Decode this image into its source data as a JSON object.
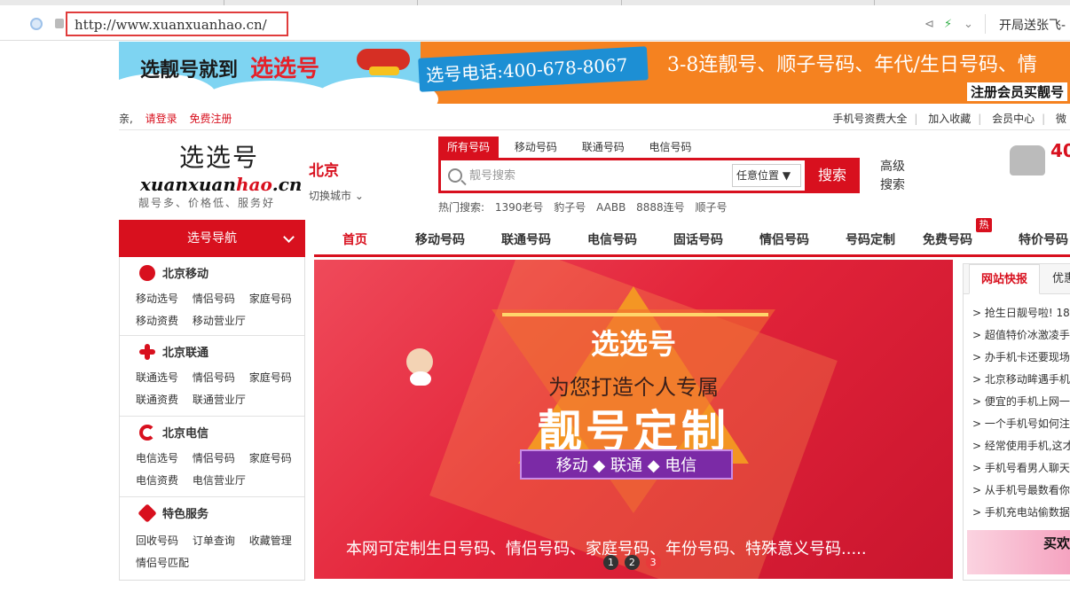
{
  "browser": {
    "url": "http://www.xuanxuanhao.cn/",
    "title": "开局送张飞-"
  },
  "banner": {
    "slogan_prefix": "选靓号就到",
    "slogan_brand": "选选号",
    "phone": "选号电话:400-678-8067",
    "promo": "3-8连靓号、顺子号码、年代/生日号码、情",
    "register": "注册会员买靓号"
  },
  "topbar": {
    "greeting": "亲,",
    "login": "请登录",
    "register": "免费注册",
    "links": [
      "手机号资费大全",
      "加入收藏",
      "会员中心",
      "微"
    ]
  },
  "header": {
    "logo_cn": "选选号",
    "logo_en_a": "xuanxuan",
    "logo_en_b": "hao",
    "logo_en_c": ".cn",
    "logo_tag": "靓号多、价格低、服务好",
    "city": "北京",
    "city_switch": "切换城市",
    "search_tabs": [
      "所有号码",
      "移动号码",
      "联通号码",
      "电信号码"
    ],
    "search_placeholder": "靓号搜索",
    "search_position": "任意位置",
    "search_button": "搜索",
    "advanced_search": "高级搜索",
    "hot_search_label": "热门搜索:",
    "hot_search": [
      "1390老号",
      "豹子号",
      "AABB",
      "8888连号",
      "顺子号"
    ],
    "hotline": "40"
  },
  "nav": {
    "title": "选号导航",
    "links": [
      "首页",
      "移动号码",
      "联通号码",
      "电信号码",
      "固话号码",
      "情侣号码",
      "号码定制",
      "免费号码",
      "特价号码"
    ],
    "hot_badge": "热"
  },
  "sidebar": {
    "groups": [
      {
        "title": "北京移动",
        "rows": [
          [
            "移动选号",
            "情侣号码",
            "家庭号码"
          ],
          [
            "移动资费",
            "移动营业厅"
          ]
        ]
      },
      {
        "title": "北京联通",
        "rows": [
          [
            "联通选号",
            "情侣号码",
            "家庭号码"
          ],
          [
            "联通资费",
            "联通营业厅"
          ]
        ]
      },
      {
        "title": "北京电信",
        "rows": [
          [
            "电信选号",
            "情侣号码",
            "家庭号码"
          ],
          [
            "电信资费",
            "电信营业厅"
          ]
        ]
      },
      {
        "title": "特色服务",
        "rows": [
          [
            "回收号码",
            "订单查询",
            "收藏管理"
          ],
          [
            "情侣号匹配"
          ]
        ]
      }
    ]
  },
  "hero": {
    "brand": "选选号",
    "sub": "为您打造个人专属",
    "main": "靓号定制",
    "carriers": "移动 ◆ 联通 ◆ 电信",
    "caption": "本网可定制生日号码、情侣号码、家庭号码、年份号码、特殊意义号码.....",
    "dots": [
      "1",
      "2",
      "3"
    ],
    "current_slide": 3
  },
  "news": {
    "tabs": [
      "网站快报",
      "优惠"
    ],
    "items": [
      "> 抢生日靓号啦! 18",
      "> 超值特价冰激凌手机",
      "> 办手机卡还要现场拍",
      "> 北京移动眸遇手机",
      "> 便宜的手机上网一",
      "> 一个手机号如何注册",
      "> 经常使用手机,这才",
      "> 手机号看男人聊天(",
      "> 从手机号最数看你",
      "> 手机充电站偷数据不"
    ],
    "ad_text": "买欢"
  }
}
